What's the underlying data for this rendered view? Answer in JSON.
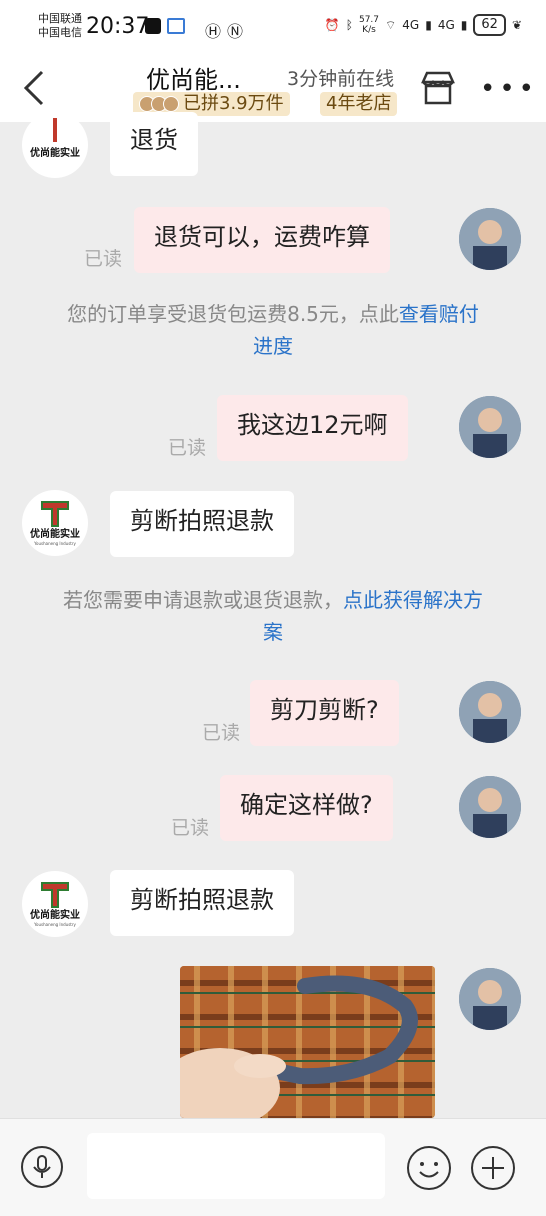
{
  "status_bar": {
    "carrier1": "中国联通",
    "carrier2": "中国电信",
    "time": "20:37",
    "speed_value": "57.7",
    "speed_unit": "K/s",
    "network1": "4G",
    "network2": "4G",
    "battery": "62"
  },
  "header": {
    "shop_name": "优尚能...",
    "online_status": "3分钟前在线",
    "badge_group": "已拼3.9万件",
    "badge_age": "4年老店"
  },
  "shop": {
    "logo_letter": "T",
    "logo_text": "优尚能实业",
    "logo_sub": "Youshaneng Industry"
  },
  "messages": [
    {
      "side": "shop",
      "text": "退货"
    },
    {
      "side": "me",
      "text": "退货可以，运费咋算",
      "read": "已读"
    },
    {
      "side": "system",
      "text": "您的订单享受退货包运费8.5元，点此",
      "link": "查看赔付进度"
    },
    {
      "side": "me",
      "text": "我这边12元啊",
      "read": "已读"
    },
    {
      "side": "shop",
      "text": "剪断拍照退款"
    },
    {
      "side": "system",
      "text": "若您需要申请退款或退货退款，",
      "link": "点此获得解决方案"
    },
    {
      "side": "me",
      "text": "剪刀剪断?",
      "read": "已读"
    },
    {
      "side": "me",
      "text": "确定这样做?",
      "read": "已读"
    },
    {
      "side": "shop",
      "text": "剪断拍照退款"
    },
    {
      "side": "me",
      "type": "image"
    }
  ],
  "colors": {
    "my_bubble": "#fde9ea",
    "link": "#2a73c9",
    "badge_bg": "#f6e7c9"
  }
}
